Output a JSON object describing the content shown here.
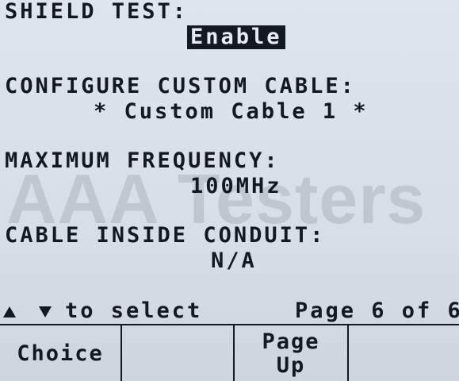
{
  "settings": {
    "shield_test": {
      "label": "SHIELD TEST:",
      "value": "Enable"
    },
    "custom_cable": {
      "label": "CONFIGURE CUSTOM CABLE:",
      "value": "* Custom Cable 1 *"
    },
    "max_frequency": {
      "label": "MAXIMUM FREQUENCY:",
      "value": "100MHz"
    },
    "cable_conduit": {
      "label": "CABLE INSIDE CONDUIT:",
      "value": "N/A"
    }
  },
  "watermark": "AAA Testers",
  "navigation": {
    "hint": "to select",
    "page_info": "Page 6 of 6",
    "icons": [
      "arrow-up-icon",
      "arrow-down-icon"
    ]
  },
  "softkeys": {
    "key1": "Choice",
    "key3_line1": "Page",
    "key3_line2": "Up"
  }
}
